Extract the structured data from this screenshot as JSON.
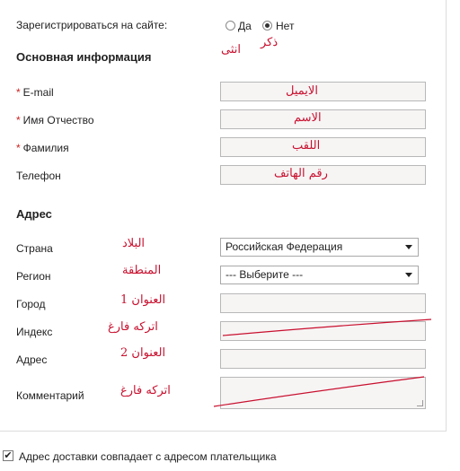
{
  "register": {
    "label": "Зарегистрироваться на сайте:",
    "yes": "Да",
    "no": "Нет",
    "note_female": "انثى",
    "note_male": "ذكر"
  },
  "basic": {
    "heading": "Основная информация",
    "email_label": "E-mail",
    "email_note": "الايميل",
    "name_label": "Имя Отчество",
    "name_note": "الاسم",
    "surname_label": "Фамилия",
    "surname_note": "اللقب",
    "phone_label": "Телефон",
    "phone_note": "رقم الهاتف",
    "required_mark": "*"
  },
  "address": {
    "heading": "Адрес",
    "country_label": "Страна",
    "country_note": "البلاد",
    "country_value": "Российская Федерация",
    "region_label": "Регион",
    "region_note": "المنطقة",
    "region_value": "--- Выберите ---",
    "city_label": "Город",
    "city_note": "العنوان 1",
    "index_label": "Индекс",
    "index_note": "اتركه فارغ",
    "address_label": "Адрес",
    "address_note": "العنوان 2",
    "comment_label": "Комментарий",
    "comment_note": "اتركه فارغ"
  },
  "delivery": {
    "checkbox_label": "Адрес доставки совпадает с адресом плательщика",
    "checked": true
  },
  "colors": {
    "annotation": "#c8102e",
    "field_bg": "#f7f4f4",
    "required": "#cc2222"
  }
}
